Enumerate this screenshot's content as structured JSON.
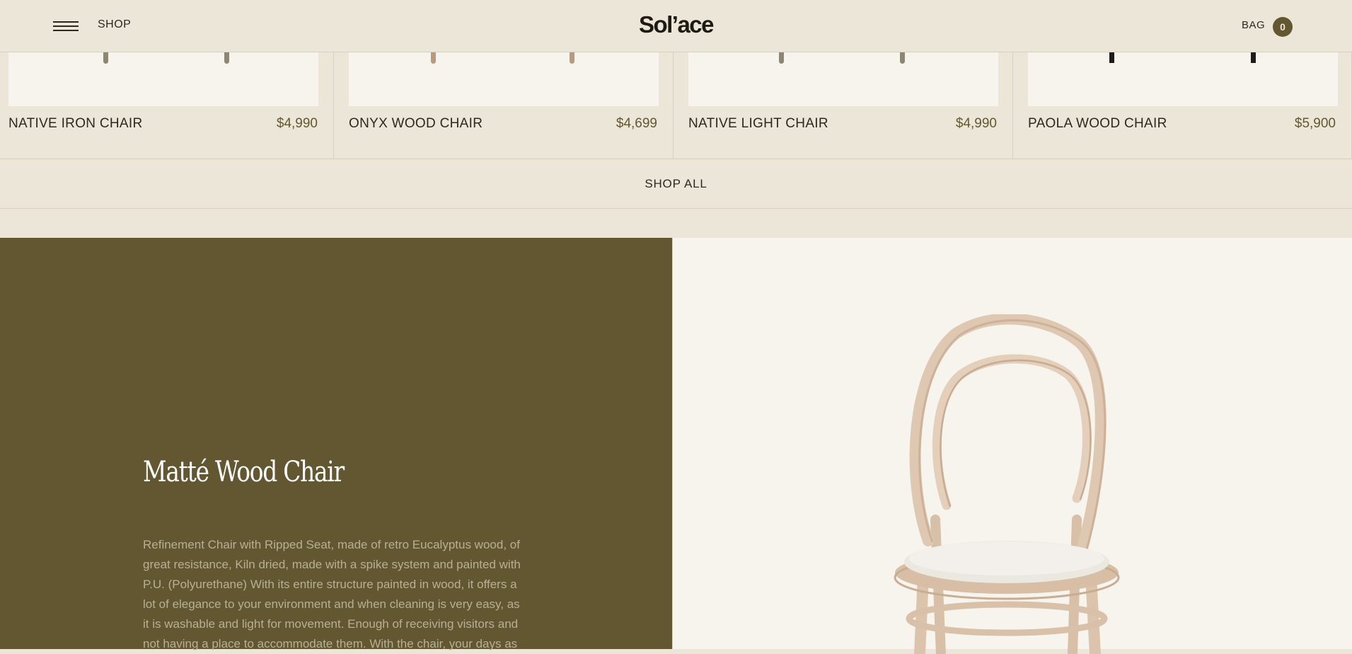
{
  "header": {
    "shop_label": "SHOP",
    "logo": "Sol’ace",
    "bag_label": "BAG",
    "bag_count": "0"
  },
  "products": [
    {
      "name": "NATIVE IRON CHAIR",
      "price": "$4,990"
    },
    {
      "name": "ONYX WOOD CHAIR",
      "price": "$4,699"
    },
    {
      "name": "NATIVE LIGHT CHAIR",
      "price": "$4,990"
    },
    {
      "name": "PAOLA WOOD CHAIR",
      "price": "$5,900"
    }
  ],
  "shop_all_label": "SHOP ALL",
  "feature": {
    "title": "Matté Wood Chair",
    "description": "Refinement Chair with Ripped Seat, made of retro Eucalyptus wood, of great resistance, Kiln dried, made with a spike system and painted with P.U. (Polyurethane) With its entire structure painted in wood, it offers a lot of elegance to your environment and when cleaning is very easy, as it is washable and light for movement. Enough of receiving visitors and not having a place to accommodate them. With the chair, your days as"
  },
  "colors": {
    "background": "#ece6d8",
    "accent_olive": "#635731",
    "price_text": "#635731",
    "panel_light": "#f7f4ee"
  },
  "icons": [
    "menu-icon",
    "chair-image"
  ]
}
